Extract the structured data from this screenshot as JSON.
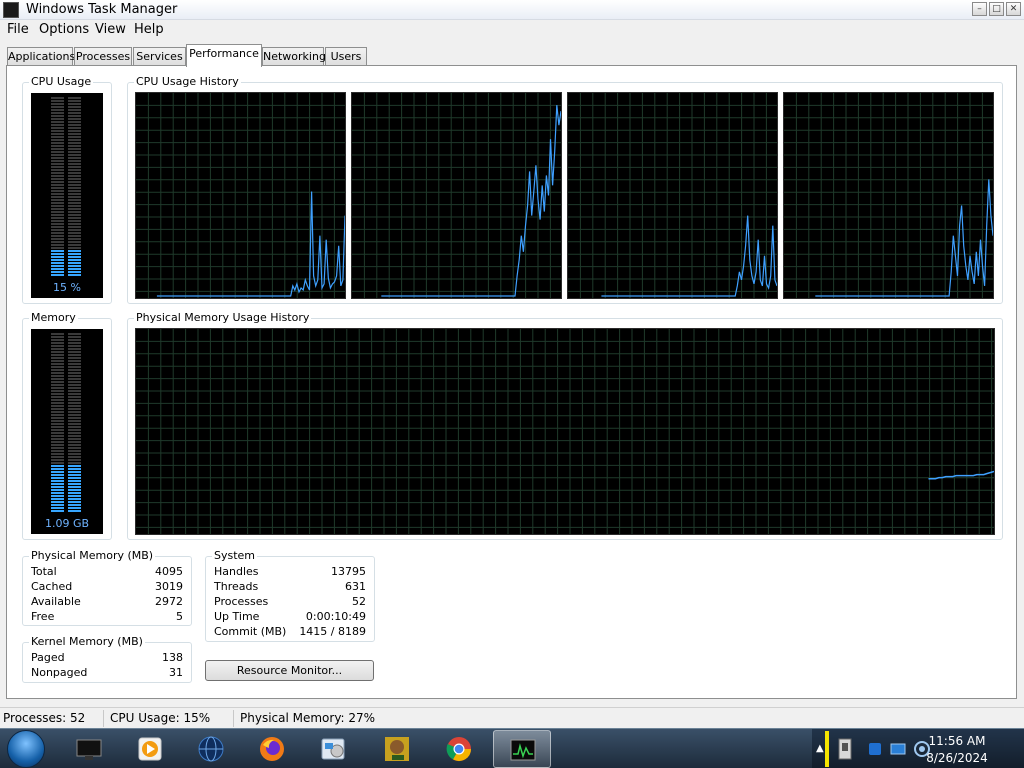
{
  "window": {
    "title": "Windows Task Manager"
  },
  "menu": [
    "File",
    "Options",
    "View",
    "Help"
  ],
  "tabs": [
    {
      "label": "Applications",
      "active": false
    },
    {
      "label": "Processes",
      "active": false
    },
    {
      "label": "Services",
      "active": false
    },
    {
      "label": "Performance",
      "active": true
    },
    {
      "label": "Networking",
      "active": false
    },
    {
      "label": "Users",
      "active": false
    }
  ],
  "cpu": {
    "group_title": "CPU Usage",
    "value_label": "15 %",
    "level": 0.15
  },
  "cpu_history": {
    "group_title": "CPU Usage History",
    "cores": [
      [
        0,
        0,
        0,
        0,
        0,
        0,
        0,
        0,
        0,
        0,
        0,
        0,
        0,
        0,
        0,
        0,
        0,
        0,
        0,
        0,
        0,
        0,
        0,
        0,
        0,
        0,
        0,
        0,
        0,
        0,
        0,
        0,
        0,
        0,
        0,
        0,
        0,
        0,
        0,
        0,
        0,
        0,
        0,
        0,
        0,
        0,
        0,
        0,
        0,
        0,
        0,
        0,
        0,
        0,
        0,
        0,
        0,
        0,
        0,
        0,
        0,
        0,
        0,
        0,
        0,
        5,
        3,
        6,
        2,
        4,
        3,
        8,
        5,
        3,
        52,
        10,
        5,
        8,
        30,
        4,
        6,
        28,
        9,
        4,
        6,
        7,
        10,
        25,
        5,
        8,
        40
      ],
      [
        0,
        0,
        0,
        0,
        0,
        0,
        0,
        0,
        0,
        0,
        0,
        0,
        0,
        0,
        0,
        0,
        0,
        0,
        0,
        0,
        0,
        0,
        0,
        0,
        0,
        0,
        0,
        0,
        0,
        0,
        0,
        0,
        0,
        0,
        0,
        0,
        0,
        0,
        0,
        0,
        0,
        0,
        0,
        0,
        0,
        0,
        0,
        0,
        0,
        0,
        0,
        0,
        0,
        0,
        0,
        0,
        0,
        0,
        0,
        0,
        0,
        0,
        0,
        0,
        0,
        10,
        18,
        30,
        22,
        35,
        45,
        62,
        40,
        52,
        65,
        48,
        38,
        55,
        42,
        60,
        50,
        78,
        55,
        72,
        95,
        85,
        92
      ],
      [
        0,
        0,
        0,
        0,
        0,
        0,
        0,
        0,
        0,
        0,
        0,
        0,
        0,
        0,
        0,
        0,
        0,
        0,
        0,
        0,
        0,
        0,
        0,
        0,
        0,
        0,
        0,
        0,
        0,
        0,
        0,
        0,
        0,
        0,
        0,
        0,
        0,
        0,
        0,
        0,
        0,
        0,
        0,
        0,
        0,
        0,
        0,
        0,
        0,
        0,
        0,
        0,
        0,
        0,
        0,
        0,
        0,
        0,
        0,
        0,
        0,
        0,
        0,
        0,
        0,
        5,
        12,
        8,
        15,
        25,
        40,
        18,
        10,
        6,
        12,
        28,
        8,
        5,
        20,
        6,
        4,
        10,
        35,
        8,
        5
      ],
      [
        0,
        0,
        0,
        0,
        0,
        0,
        0,
        0,
        0,
        0,
        0,
        0,
        0,
        0,
        0,
        0,
        0,
        0,
        0,
        0,
        0,
        0,
        0,
        0,
        0,
        0,
        0,
        0,
        0,
        0,
        0,
        0,
        0,
        0,
        0,
        0,
        0,
        0,
        0,
        0,
        0,
        0,
        0,
        0,
        0,
        0,
        0,
        0,
        0,
        0,
        0,
        0,
        0,
        0,
        0,
        0,
        0,
        0,
        0,
        0,
        0,
        0,
        0,
        0,
        0,
        12,
        30,
        20,
        10,
        35,
        45,
        25,
        15,
        8,
        20,
        12,
        6,
        22,
        10,
        28,
        15,
        5,
        35,
        58,
        40,
        30
      ]
    ]
  },
  "memory": {
    "group_title": "Memory",
    "value_label": "1.09 GB",
    "level": 0.27
  },
  "memory_history": {
    "group_title": "Physical Memory Usage History",
    "values": [
      27,
      27,
      27,
      27.5,
      27.5,
      28,
      28,
      28,
      28.5,
      28.5,
      28.5,
      28.5,
      28.5,
      28.5,
      29,
      29,
      29,
      29.5,
      30,
      30.5
    ]
  },
  "physical_memory": {
    "title": "Physical Memory (MB)",
    "rows": [
      {
        "label": "Total",
        "value": "4095"
      },
      {
        "label": "Cached",
        "value": "3019"
      },
      {
        "label": "Available",
        "value": "2972"
      },
      {
        "label": "Free",
        "value": "5"
      }
    ]
  },
  "kernel_memory": {
    "title": "Kernel Memory (MB)",
    "rows": [
      {
        "label": "Paged",
        "value": "138"
      },
      {
        "label": "Nonpaged",
        "value": "31"
      }
    ]
  },
  "system": {
    "title": "System",
    "rows": [
      {
        "label": "Handles",
        "value": "13795"
      },
      {
        "label": "Threads",
        "value": "631"
      },
      {
        "label": "Processes",
        "value": "52"
      },
      {
        "label": "Up Time",
        "value": "0:00:10:49"
      },
      {
        "label": "Commit (MB)",
        "value": "1415 / 8189"
      }
    ]
  },
  "resource_monitor_label": "Resource Monitor...",
  "status": {
    "processes": "Processes: 52",
    "cpu": "CPU Usage: 15%",
    "memory": "Physical Memory: 27%"
  },
  "taskbar": {
    "icons": [
      "monitor-icon",
      "media-player-icon",
      "globe-icon",
      "firefox-icon",
      "control-panel-icon",
      "box-app-icon",
      "chrome-icon",
      "task-manager-icon"
    ],
    "active_icon": "task-manager-icon",
    "clock_time": "11:56 AM",
    "clock_date": "8/26/2024"
  },
  "colors": {
    "graph_bg": "#000000",
    "grid": "#1f3a2b",
    "line": "#3fa0ff",
    "meter_on": "#37a6ff",
    "meter_off": "#3a3a3a"
  }
}
